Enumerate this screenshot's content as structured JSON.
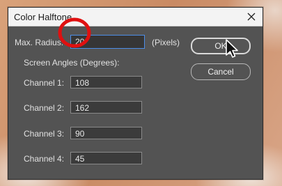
{
  "dialog": {
    "title": "Color Halftone",
    "max_radius_label": "Max. Radius:",
    "max_radius_value": "20",
    "units_label": "(Pixels)",
    "screen_angles_label": "Screen Angles (Degrees):",
    "channels": [
      {
        "label": "Channel 1:",
        "value": "108"
      },
      {
        "label": "Channel 2:",
        "value": "162"
      },
      {
        "label": "Channel 3:",
        "value": "90"
      },
      {
        "label": "Channel 4:",
        "value": "45"
      }
    ],
    "ok_label": "OK",
    "cancel_label": "Cancel"
  },
  "colors": {
    "dialog_bg": "#535353",
    "focus_border": "#4d8ee8",
    "annotation_ring": "#e01010"
  }
}
